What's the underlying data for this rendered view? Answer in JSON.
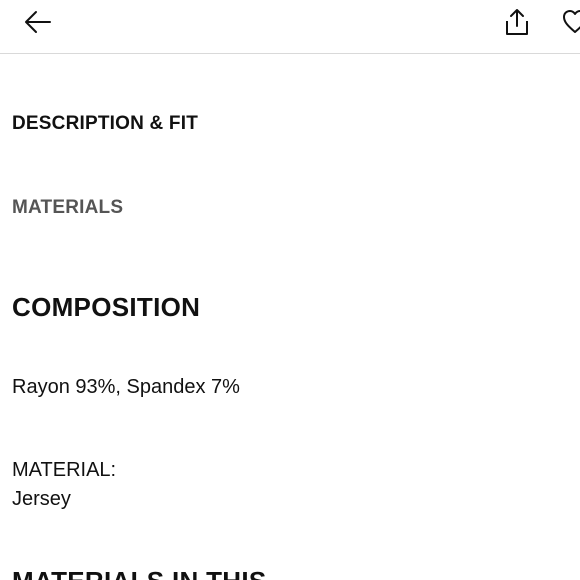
{
  "header": {
    "back_icon": "arrow-left-icon",
    "share_icon": "share-icon",
    "favorite_icon": "heart-icon"
  },
  "tabs": [
    {
      "label": "DESCRIPTION & FIT"
    },
    {
      "label": "MATERIALS"
    }
  ],
  "composition": {
    "title": "COMPOSITION",
    "value": "Rayon 93%, Spandex 7%"
  },
  "material": {
    "label": "MATERIAL:",
    "value": "Jersey"
  },
  "next_section": {
    "title": "MATERIALS IN THIS"
  },
  "colors": {
    "text": "#111111",
    "muted_tab": "#555555",
    "divider": "#d9d9d9"
  }
}
